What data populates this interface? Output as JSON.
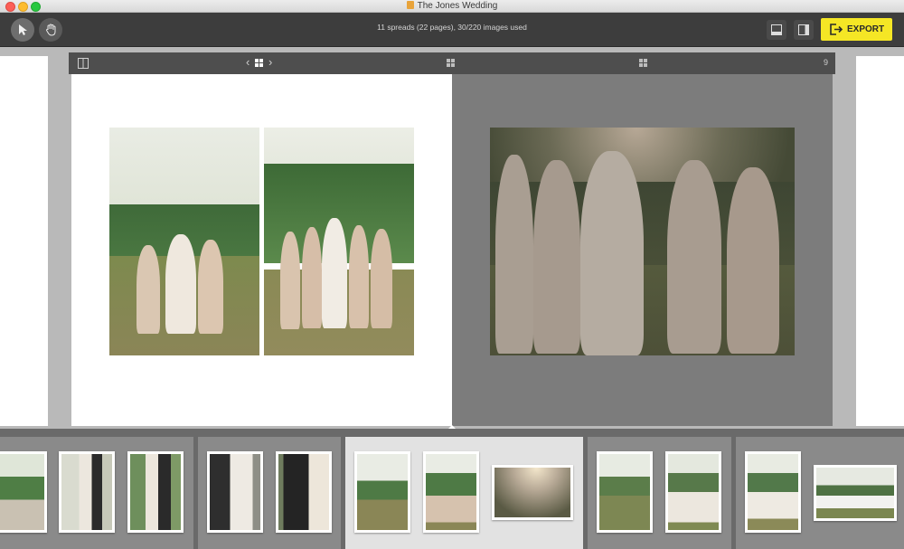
{
  "window": {
    "title": "The Jones Wedding"
  },
  "toolbar": {
    "status": "11 spreads (22 pages), 30/220 images used",
    "export_label": "EXPORT",
    "tools": [
      "pointer-tool",
      "hand-tool"
    ],
    "accent_color": "#f5e625"
  },
  "spread": {
    "page_number": "9",
    "nav_prev": "‹",
    "nav_next": "›"
  },
  "filmstrip": {
    "groups": [
      {
        "thumbs": 3
      },
      {
        "thumbs": 2
      },
      {
        "thumbs": 3,
        "selected": true
      },
      {
        "thumbs": 2
      },
      {
        "thumbs": 2
      }
    ]
  }
}
